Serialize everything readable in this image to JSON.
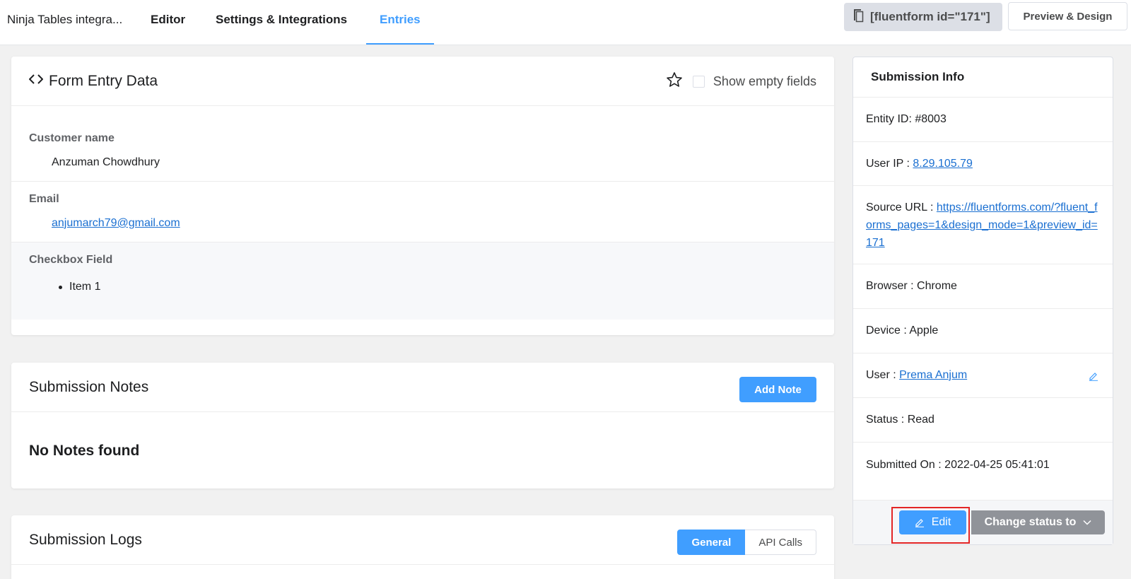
{
  "header": {
    "form_title": "Ninja Tables integra...",
    "tabs": [
      {
        "label": "Editor"
      },
      {
        "label": "Settings & Integrations"
      },
      {
        "label": "Entries"
      }
    ],
    "shortcode": "[fluentform id=\"171\"]",
    "preview_label": "Preview & Design",
    "accent_color": "#409eff"
  },
  "entry": {
    "title": "Form Entry Data",
    "show_empty_label": "Show empty fields",
    "show_empty_checked": false,
    "fields": {
      "customer": {
        "label": "Customer name",
        "value": "Anzuman Chowdhury"
      },
      "email": {
        "label": "Email",
        "value": "anjumarch79@gmail.com"
      },
      "checkbox": {
        "label": "Checkbox Field",
        "items": [
          "Item 1"
        ]
      }
    }
  },
  "notes": {
    "title": "Submission Notes",
    "add_label": "Add Note",
    "empty_text": "No Notes found"
  },
  "logs": {
    "title": "Submission Logs",
    "tabs": [
      {
        "label": "General"
      },
      {
        "label": "API Calls"
      }
    ]
  },
  "info": {
    "title": "Submission Info",
    "entity_id": "Entity ID: #8003",
    "user_ip_label": "User IP :",
    "user_ip": "8.29.105.79",
    "source_label": "Source URL :",
    "source_url": "https://fluentforms.com/?fluent_forms_pages=1&design_mode=1&preview_id=171",
    "browser": "Browser : Chrome",
    "device": "Device : Apple",
    "user_label": "User :",
    "user_name": "Prema Anjum",
    "status": "Status : Read",
    "submitted_on": "Submitted On : 2022-04-25 05:41:01",
    "edit_label": "Edit",
    "change_status_label": "Change status to"
  }
}
